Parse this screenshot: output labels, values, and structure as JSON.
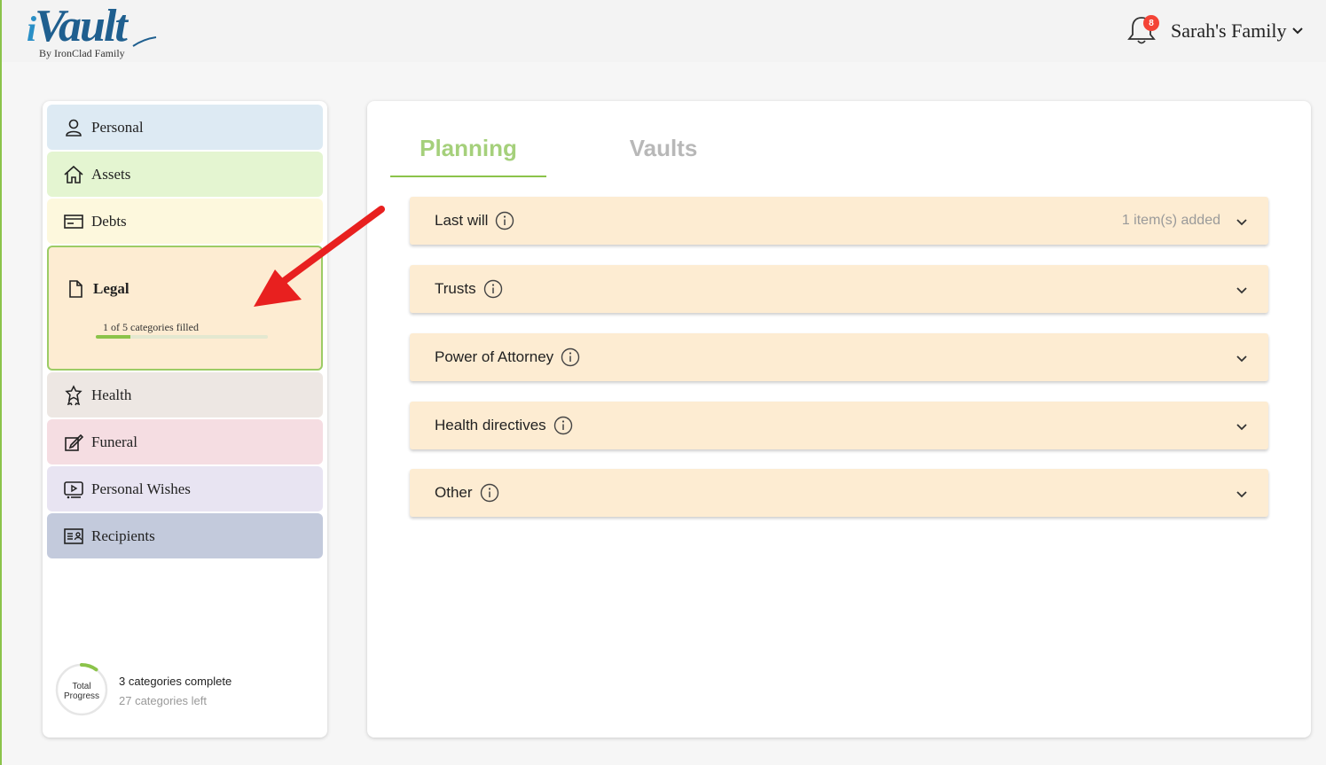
{
  "header": {
    "logo_main": "Vault",
    "logo_prefix": "i",
    "logo_sub": "By IronClad Family",
    "notification_count": "8",
    "family_name": "Sarah's Family"
  },
  "sidebar": {
    "items": [
      {
        "label": "Personal",
        "color": "#ddeaf3"
      },
      {
        "label": "Assets",
        "color": "#e4f5d1"
      },
      {
        "label": "Debts",
        "color": "#fdf8dd"
      },
      {
        "label": "Legal",
        "color": "#fdecd2"
      },
      {
        "label": "Health",
        "color": "#ede7e3"
      },
      {
        "label": "Funeral",
        "color": "#f5dde2"
      },
      {
        "label": "Personal Wishes",
        "color": "#e8e4f2"
      },
      {
        "label": "Recipients",
        "color": "#c3cadc"
      }
    ],
    "legal_progress_text": "1 of 5 categories filled",
    "legal_progress_fraction": 0.2,
    "total_progress_label_1": "Total",
    "total_progress_label_2": "Progress",
    "total_progress_fraction": 0.1,
    "categories_complete": "3 categories complete",
    "categories_left": "27 categories left"
  },
  "main": {
    "tabs": [
      {
        "label": "Planning",
        "active": true
      },
      {
        "label": "Vaults",
        "active": false
      }
    ],
    "accordions": [
      {
        "title": "Last will",
        "count": "1 item(s) added"
      },
      {
        "title": "Trusts",
        "count": ""
      },
      {
        "title": "Power of Attorney",
        "count": ""
      },
      {
        "title": "Health directives",
        "count": ""
      },
      {
        "title": "Other",
        "count": ""
      }
    ]
  },
  "colors": {
    "accent_green": "#8bc34a",
    "annotation_red": "#e8201f",
    "logo_blue": "#1f5f8f"
  }
}
